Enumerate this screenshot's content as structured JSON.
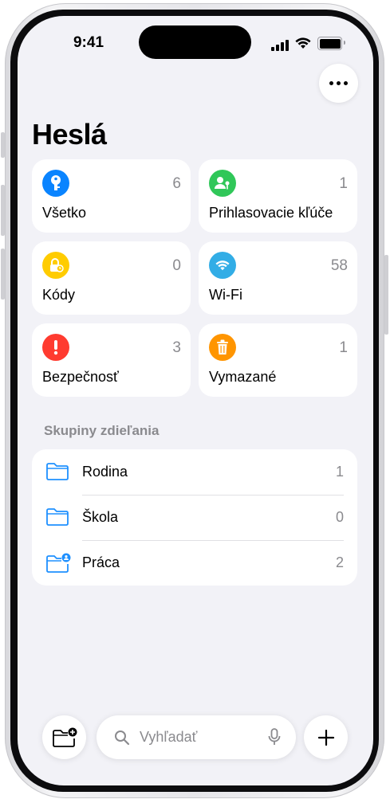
{
  "status": {
    "time": "9:41"
  },
  "header": {
    "title": "Heslá",
    "more_icon": "ellipsis-icon"
  },
  "colors": {
    "blue": "#0a84ff",
    "green": "#30c759",
    "yellow": "#ffcc00",
    "cyan": "#32ade6",
    "red": "#ff3b30",
    "orange": "#ff9500",
    "folder": "#1e90ff"
  },
  "categories": [
    {
      "label": "Všetko",
      "count": "6",
      "icon": "key-icon",
      "color": "#0a84ff"
    },
    {
      "label": "Prihlasovacie kľúče",
      "count": "1",
      "icon": "passkey-person-icon",
      "color": "#30c759"
    },
    {
      "label": "Kódy",
      "count": "0",
      "icon": "lock-clock-icon",
      "color": "#ffcc00"
    },
    {
      "label": "Wi-Fi",
      "count": "58",
      "icon": "wifi-icon",
      "color": "#32ade6"
    },
    {
      "label": "Bezpečnosť",
      "count": "3",
      "icon": "exclamation-icon",
      "color": "#ff3b30"
    },
    {
      "label": "Vymazané",
      "count": "1",
      "icon": "trash-icon",
      "color": "#ff9500"
    }
  ],
  "shared_groups": {
    "header": "Skupiny zdieľania",
    "items": [
      {
        "name": "Rodina",
        "count": "1",
        "icon": "folder-icon"
      },
      {
        "name": "Škola",
        "count": "0",
        "icon": "folder-icon"
      },
      {
        "name": "Práca",
        "count": "2",
        "icon": "folder-person-icon"
      }
    ]
  },
  "bottom_bar": {
    "new_group_icon": "folder-plus-icon",
    "search_placeholder": "Vyhľadať",
    "search_icon": "magnifier-icon",
    "mic_icon": "microphone-icon",
    "add_icon": "plus-icon"
  }
}
